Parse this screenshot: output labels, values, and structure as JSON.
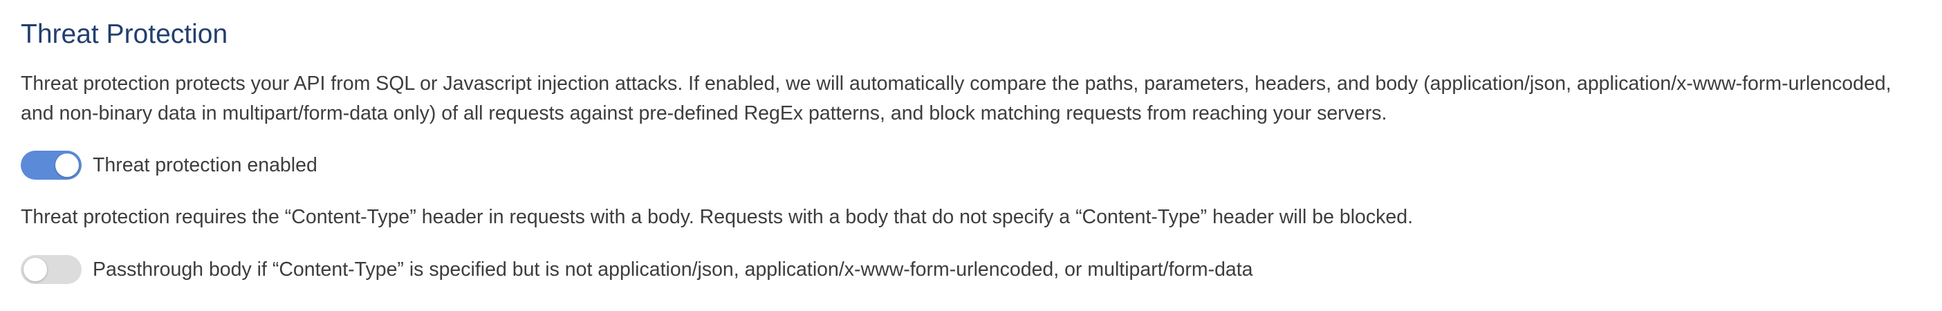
{
  "section": {
    "title": "Threat Protection",
    "description": "Threat protection protects your API from SQL or Javascript injection attacks. If enabled, we will automatically compare the paths, parameters, headers, and body (application/json, application/x-www-form-urlencoded, and non-binary data in multipart/form-data only) of all requests against pre-defined RegEx patterns, and block matching requests from reaching your servers.",
    "threat_toggle": {
      "label": "Threat protection enabled",
      "state": "on"
    },
    "content_type_note": "Threat protection requires the “Content-Type” header in requests with a body. Requests with a body that do not specify a “Content-Type” header will be blocked.",
    "passthrough_toggle": {
      "label": "Passthrough body if “Content-Type” is specified but is not application/json, application/x-www-form-urlencoded, or multipart/form-data",
      "state": "off"
    }
  },
  "colors": {
    "title": "#223f6e",
    "toggle_on": "#5b8ad8",
    "toggle_off": "#dcdcdc"
  }
}
